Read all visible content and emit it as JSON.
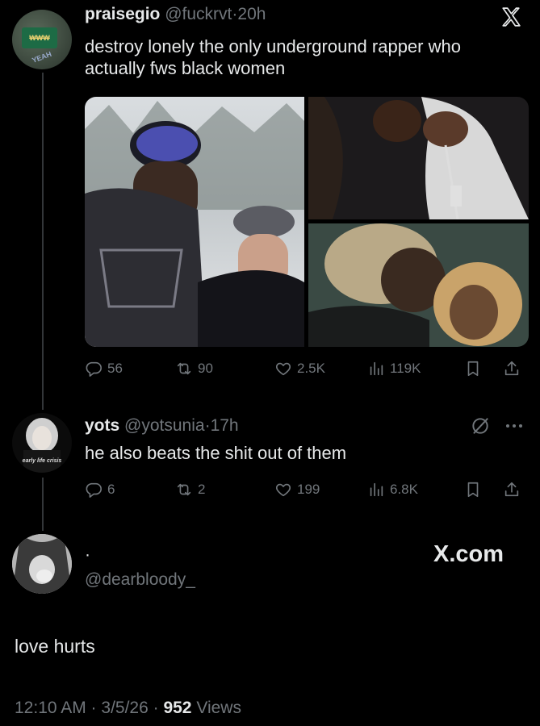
{
  "tweet1": {
    "name": "praisegio",
    "handle": "@fuckrvt",
    "sep": "·",
    "time": "20h",
    "text_line1": "destroy lonely the only underground rapper who",
    "text_line2": "actually fws black women",
    "stats": {
      "replies": "56",
      "retweets": "90",
      "likes": "2.5K",
      "views": "119K"
    },
    "avatar_caption": "YEAH"
  },
  "tweet2": {
    "name": "yots",
    "handle": "@yotsunia",
    "sep": "·",
    "time": "17h",
    "text": "he also beats the shit out of them",
    "stats": {
      "replies": "6",
      "retweets": "2",
      "likes": "199",
      "views": "6.8K"
    },
    "avatar_caption": "early life crisis"
  },
  "quote": {
    "name": "·",
    "handle": "@dearbloody_",
    "brand": "X.com",
    "text": "love hurts",
    "timestamp": "12:10 AM · 3/5/26 · ",
    "views_count": "952",
    "views_label": " Views"
  },
  "colors": {
    "background": "#000000",
    "text": "#e7e9ea",
    "muted": "#71767b",
    "line": "#333639"
  },
  "icons": [
    "x-logo-icon",
    "reply-icon",
    "retweet-icon",
    "like-icon",
    "views-icon",
    "bookmark-icon",
    "share-icon",
    "grok-icon",
    "more-icon"
  ]
}
